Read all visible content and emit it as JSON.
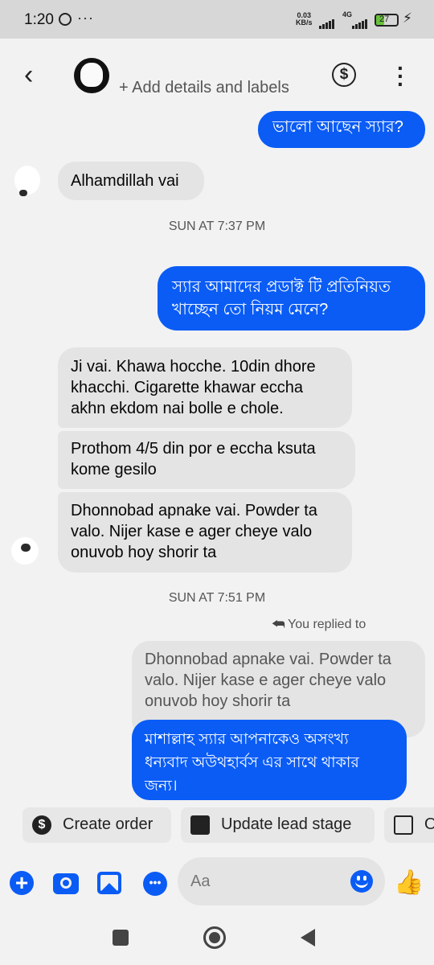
{
  "status_bar": {
    "time": "1:20",
    "more": "···",
    "speed": "0.03\nKB/s",
    "network": "4G",
    "battery": "27"
  },
  "header": {
    "back_icon": "chevron-left-icon",
    "subtitle": "+ Add details and labels",
    "dollar_icon": "dollar-circle-icon",
    "more_icon": "vertical-dots-icon"
  },
  "messages": [
    {
      "side": "out",
      "text": "ভালো আছেন স্যার?"
    },
    {
      "side": "in",
      "text": "Alhamdillah vai"
    },
    {
      "type": "timestamp",
      "text": "SUN AT 7:37 PM"
    },
    {
      "side": "out",
      "text": "স্যার আমাদের প্রডাক্ট টি প্রতিনিয়ত খাচ্ছেন তো নিয়ম মেনে?"
    },
    {
      "side": "in",
      "text": "Ji vai. Khawa hocche. 10din dhore khacchi. Cigarette khawar eccha akhn ekdom nai bolle e chole."
    },
    {
      "side": "in",
      "text": "Prothom 4/5 din por e eccha ksuta kome gesilo"
    },
    {
      "side": "in",
      "text": "Dhonnobad apnake vai. Powder ta valo. Nijer kase e ager cheye valo onuvob hoy shorir ta"
    },
    {
      "type": "timestamp",
      "text": "SUN AT 7:51 PM"
    },
    {
      "type": "reply_label",
      "text": "You replied to"
    },
    {
      "type": "quoted",
      "text": "Dhonnobad apnake vai. Powder ta valo. Nijer kase e ager cheye valo onuvob hoy shorir ta"
    },
    {
      "side": "out",
      "text": "মাশাল্লাহ স্যার আপনাকেও অসংখ্য ধন্যবাদ অউথহার্বস এর সাথে থাকার জন্য।"
    }
  ],
  "actions": {
    "create_order": "Create order",
    "update_lead_stage": "Update lead stage",
    "third": "O"
  },
  "composer": {
    "placeholder": "Aa"
  },
  "colors": {
    "accent": "#0a5cf5",
    "incoming_bubble": "#e4e4e4",
    "background": "#f2f2f2"
  }
}
